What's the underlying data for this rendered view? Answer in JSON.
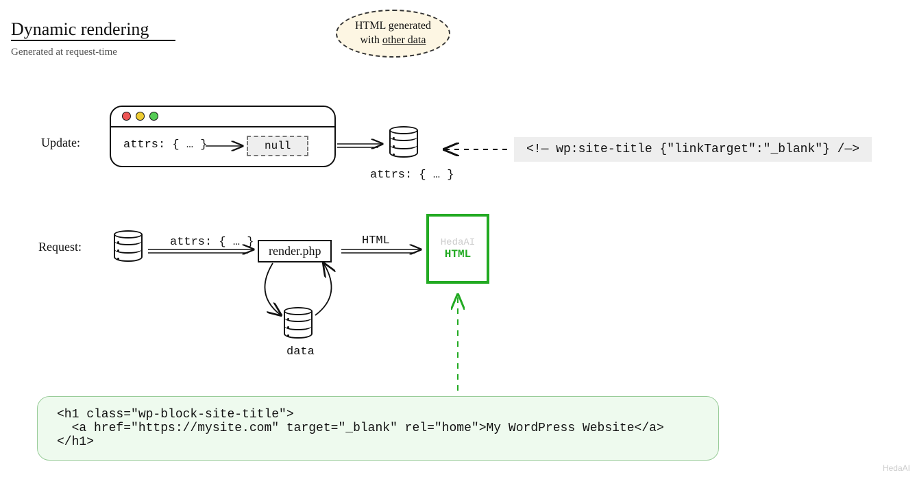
{
  "title": "Dynamic rendering",
  "subtitle": "Generated at request-time",
  "bubble": {
    "line1": "HTML generated",
    "line2_pre": "with ",
    "line2_u": "other data"
  },
  "update_label": "Update:",
  "request_label": "Request:",
  "window": {
    "attrs_text": "attrs: { … }",
    "null_text": "null"
  },
  "db_caption": "attrs: { … }",
  "code_comment": "<!— wp:site-title {\"linkTarget\":\"_blank\"} /—>",
  "attrs_flow": "attrs: { … }",
  "render_file": "render.php",
  "html_label": "HTML",
  "data_label": "data",
  "html_box": {
    "faint": "HedaAI",
    "bold": "HTML"
  },
  "output_code": "<h1 class=\"wp-block-site-title\">\n  <a href=\"https://mysite.com\" target=\"_blank\" rel=\"home\">My WordPress Website</a>\n</h1>",
  "watermark": "HedaAI"
}
